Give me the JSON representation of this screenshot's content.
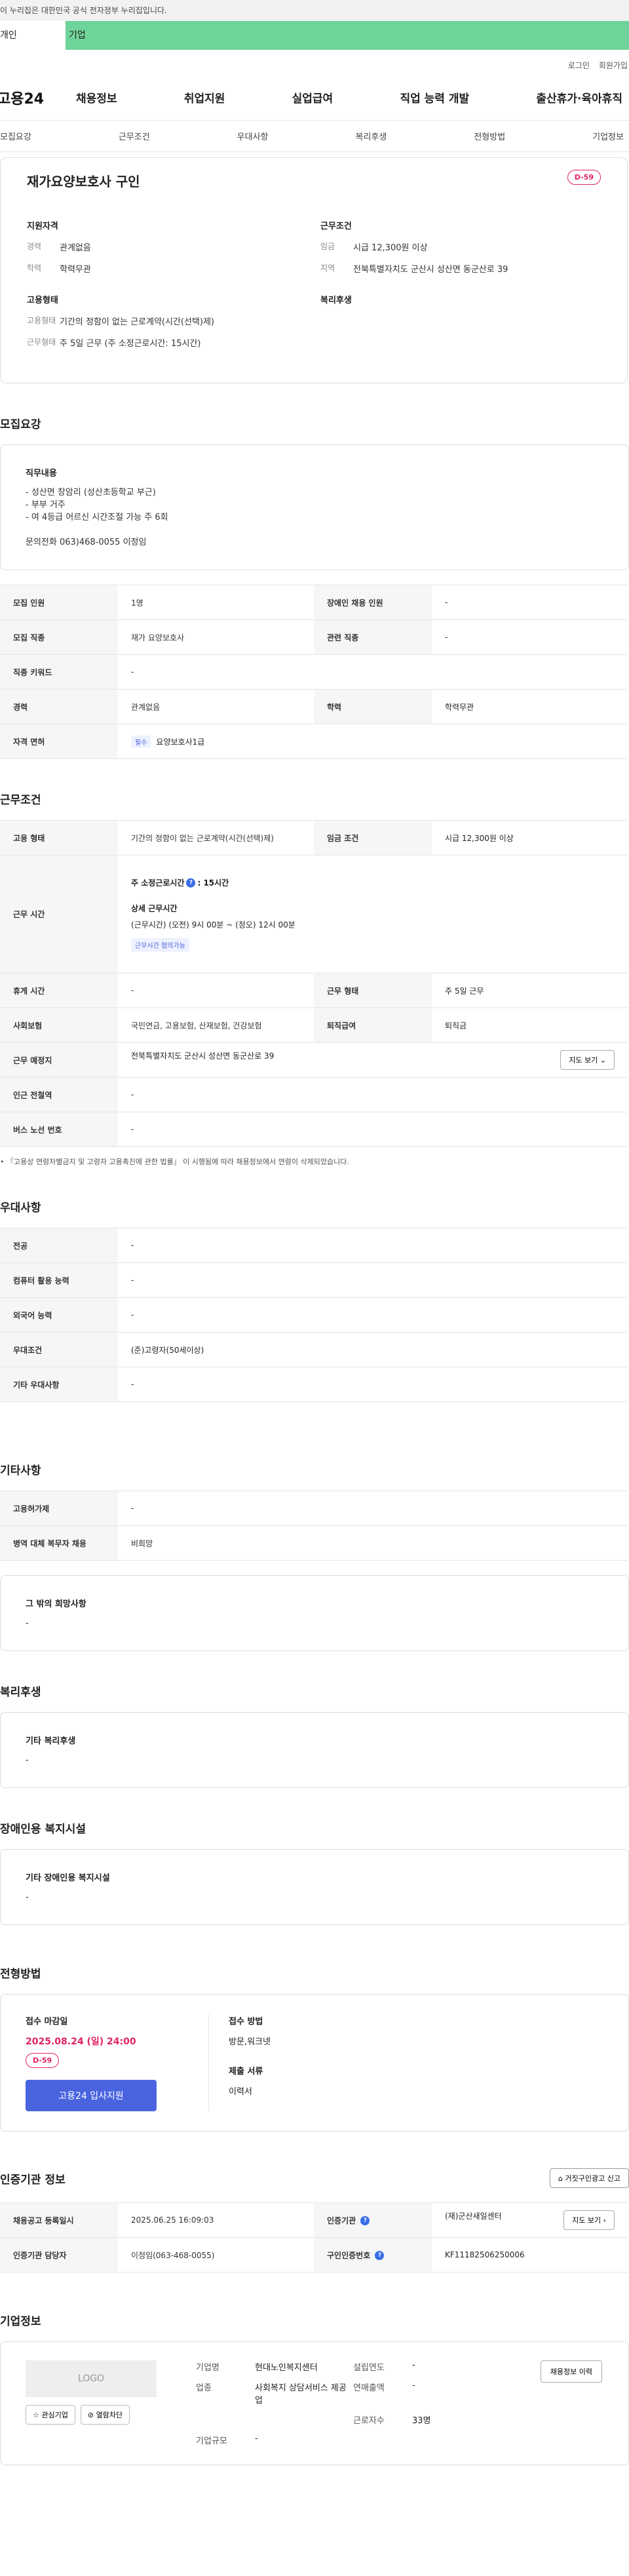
{
  "gov_banner": "이 누리집은 대한민국 공식 전자정부 누리집입니다.",
  "tabs": [
    "개인",
    "기업"
  ],
  "util": [
    "로그인",
    "회원가입"
  ],
  "logo": "고용24",
  "gnb": [
    "채용정보",
    "취업지원",
    "실업급여",
    "직업 능력 개발",
    "출산휴가·육아휴직"
  ],
  "subnav": [
    "모집요강",
    "근무조건",
    "우대사항",
    "복리후생",
    "전형방법",
    "기업정보"
  ],
  "summary": {
    "title": "재가요양보호사 구인",
    "dday": "D-59",
    "qual_title": "지원자격",
    "career_k": "경력",
    "career_v": "관계없음",
    "edu_k": "학력",
    "edu_v": "학력무관",
    "cond_title": "근무조건",
    "wage_k": "임금",
    "wage_v": "시급 12,300원 이상",
    "region_k": "지역",
    "region_v": "전북특별자치도 군산시 성산면 동군산로 39",
    "emp_title": "고용형태",
    "emp_k": "고용형태",
    "emp_v": "기간의 정함이 없는 근로계약(시간(선택)제)",
    "work_k": "근무형태",
    "work_v": "주 5일 근무 (주 소정근로시간: 15시간)",
    "welfare_title": "복리후생"
  },
  "recruit": {
    "title": "모집요강",
    "job_title": "직무내용",
    "job_lines": [
      "- 성산면 창암리 (성산초등학교 부근)",
      "- 부부 거주",
      "- 여 4등급 어르신 시간조절 가능 주 6회",
      "",
      "문의전화 063)468-0055 이정임"
    ],
    "rows": [
      [
        "모집 인원",
        "1명",
        "장애인 채용 인원",
        "-"
      ],
      [
        "모집 직종",
        "재가 요양보호사",
        "관련 직종",
        "-"
      ],
      [
        "직종 키워드",
        "-"
      ],
      [
        "경력",
        "관계없음",
        "학력",
        "학력무관"
      ]
    ],
    "license_h": "자격 면허",
    "license_badge": "필수",
    "license_v": "요양보호사1급"
  },
  "cond": {
    "title": "근무조건",
    "emp_h": "고용 형태",
    "emp_v": "기간의 정함이 없는 근로계약(시간(선택)제)",
    "wage_h": "임금 조건",
    "wage_v": "시급 12,300원 이상",
    "time_h": "근무 시간",
    "time_week": "주 소정근로시간",
    "time_week_v": ": 15시간",
    "time_detail_t": "상세 근무시간",
    "time_detail": "(근무시간) (오전) 9시 00분 ~ (정오) 12시 00분",
    "time_tag": "근무시간 협의가능",
    "rest_h": "휴게 시간",
    "rest_v": "-",
    "form_h": "근무 형태",
    "form_v": "주 5일 근무",
    "ins_h": "사회보험",
    "ins_v": "국민연금, 고용보험, 산재보험, 건강보험",
    "ret_h": "퇴직급여",
    "ret_v": "퇴직금",
    "loc_h": "근무 예정지",
    "loc_v": "전북특별자치도 군산시 성산면 동군산로 39",
    "map_btn": "지도 보기",
    "station_h": "인근 전철역",
    "station_v": "-",
    "bus_h": "버스 노선 번호",
    "bus_v": "-",
    "note": "• 『고용상 연령차별금지 및 고령자 고용촉진에 관한 법률』 이 시행됨에 따라 채용정보에서 연령이 삭제되었습니다."
  },
  "pref": {
    "title": "우대사항",
    "rows": [
      [
        "전공",
        "-"
      ],
      [
        "컴퓨터 활용 능력",
        "-"
      ],
      [
        "외국어 능력",
        "-"
      ],
      [
        "우대조건",
        "(준)고령자(50세이상)"
      ],
      [
        "기타 우대사항",
        "-"
      ]
    ]
  },
  "etc": {
    "title": "기타사항",
    "rows": [
      [
        "고용허가제",
        "-"
      ],
      [
        "병역 대체 복무자 채용",
        "비희망"
      ]
    ],
    "box_t": "그 밖의 희망사항",
    "box_v": "-"
  },
  "welfare": {
    "title": "복리후생",
    "box_t": "기타 복리후생",
    "box_v": "-"
  },
  "disabled": {
    "title": "장애인용 복지시설",
    "box_t": "기타 장애인용 복지시설",
    "box_v": "-"
  },
  "apply": {
    "title": "전형방법",
    "deadline_t": "접수 마감일",
    "deadline_v": "2025.08.24 (일) 24:00",
    "dday": "D-59",
    "btn": "고용24 입사지원",
    "method_t": "접수 방법",
    "method_v": "방문,워크넷",
    "docs_t": "제출 서류",
    "docs_v": "이력서"
  },
  "agency": {
    "title": "인증기관 정보",
    "report": "거짓구인광고 신고",
    "rows": [
      [
        "채용공고 등록일시",
        "2025.06.25 16:09:03",
        "인증기관",
        "(재)군산새일센터"
      ],
      [
        "인증기관 담당자",
        "이정임(063-468-0055)",
        "구인인증번호",
        "KF11182506250006"
      ]
    ],
    "map_btn": "지도 보기"
  },
  "company": {
    "title": "기업정보",
    "logo": "LOGO",
    "fav": "관심기업",
    "block": "열람차단",
    "history": "채용정보 이력",
    "k1": "기업명",
    "v1": "현대노인복지센터",
    "k2": "설립연도",
    "v2": "-",
    "k3": "업종",
    "v3": "사회복지 상담서비스 제공업",
    "k4": "연매출액",
    "v4": "-",
    "k5": "근로자수",
    "v5": "33명",
    "k6": "기업규모",
    "v6": "-"
  }
}
